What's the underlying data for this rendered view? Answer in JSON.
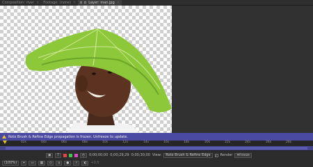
{
  "tabs": [
    {
      "label": "Composition: river",
      "active": false
    },
    {
      "label": "Footage: (none)",
      "active": false
    },
    {
      "label": "Layer: man.jpg",
      "active": true
    }
  ],
  "status": {
    "message": "Roto Brush & Refine Edge propagation is frozen. Unfreeze to update."
  },
  "ruler": {
    "ticks": [
      "02s",
      "04s",
      "06s",
      "08s",
      "10s",
      "12s",
      "14s",
      "16s",
      "18s",
      "20s",
      "22s",
      "24s",
      "26s",
      "28s"
    ]
  },
  "toolbar": {
    "zoom": "(100%)",
    "timecode_current": "0;00;00;00",
    "timecode_end": "0;00;29;29",
    "timecode_duration": "0;00;30;00",
    "view_label": "View:",
    "view_value": "Roto Brush & Refine Edge",
    "render_label": "Render",
    "freeze_label": "Freeze",
    "exposure": "+0.0"
  },
  "colors": {
    "status_bg": "#4b4aa2",
    "accent": "#e8c22a",
    "leaf": "#8cc83a"
  }
}
